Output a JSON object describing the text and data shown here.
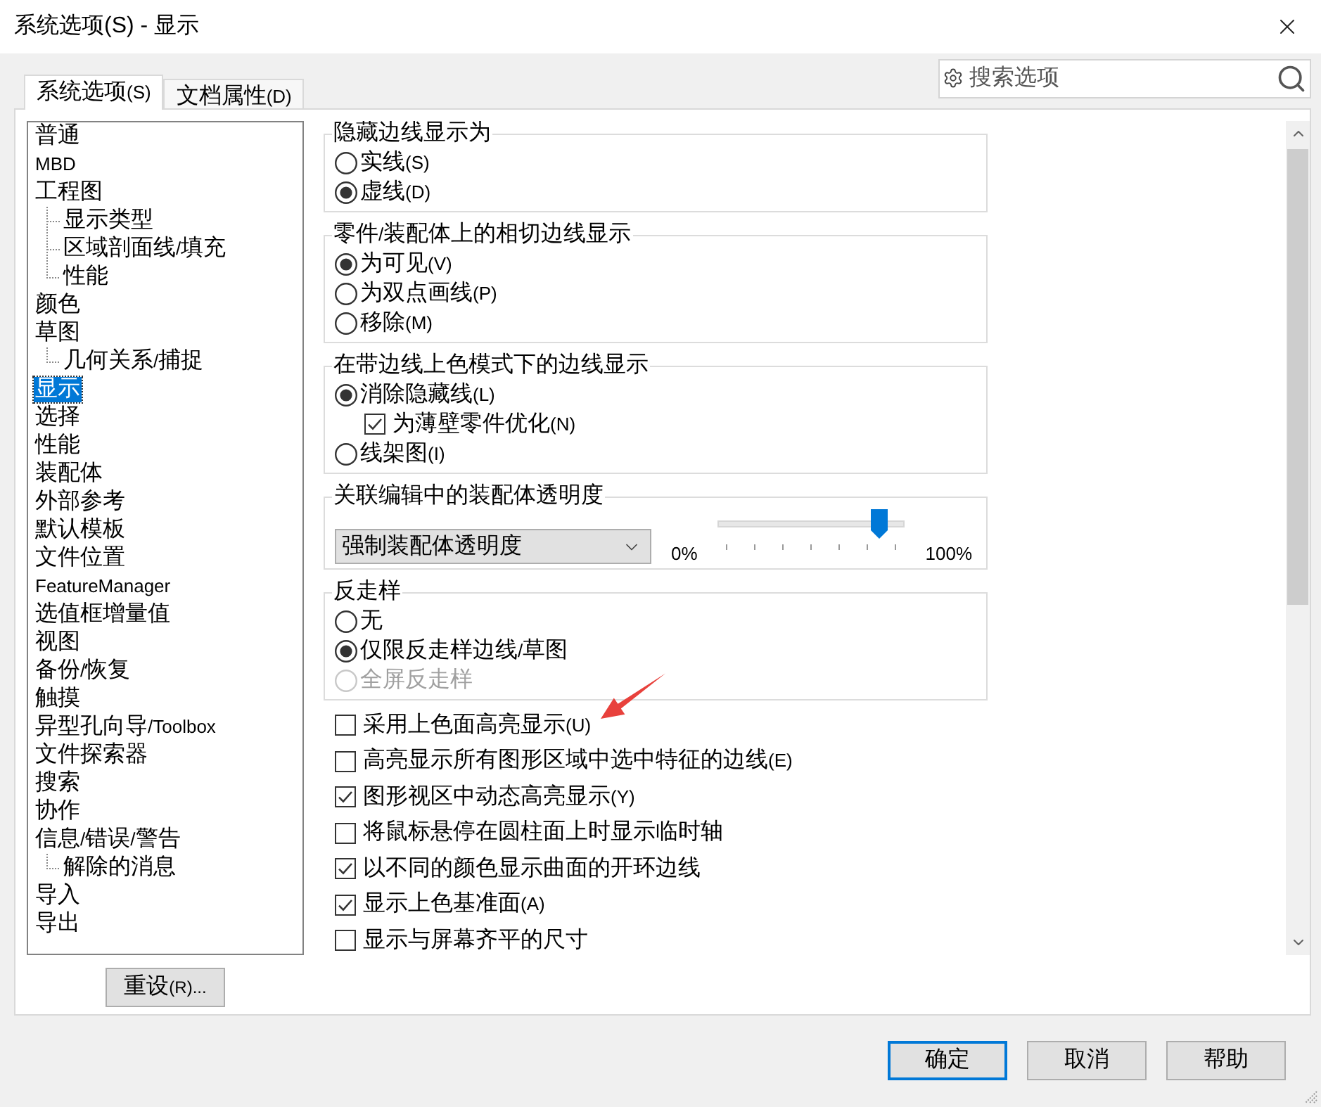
{
  "window": {
    "title": "系统选项(S) - 显示"
  },
  "tabs": [
    {
      "label": "系统选项(S)",
      "selected": true
    },
    {
      "label": "文档属性(D)",
      "selected": false
    }
  ],
  "search": {
    "placeholder": "搜索选项"
  },
  "sidebar": {
    "items": [
      {
        "label": "普通",
        "selected": false
      },
      {
        "label": "MBD",
        "selected": false
      },
      {
        "label": "工程图",
        "selected": false,
        "children": [
          {
            "label": "显示类型",
            "selected": false
          },
          {
            "label": "区域剖面线/填充",
            "selected": false
          },
          {
            "label": "性能",
            "selected": false
          }
        ]
      },
      {
        "label": "颜色",
        "selected": false
      },
      {
        "label": "草图",
        "selected": false,
        "children": [
          {
            "label": "几何关系/捕捉",
            "selected": false
          }
        ]
      },
      {
        "label": "显示",
        "selected": true
      },
      {
        "label": "选择",
        "selected": false
      },
      {
        "label": "性能",
        "selected": false
      },
      {
        "label": "装配体",
        "selected": false
      },
      {
        "label": "外部参考",
        "selected": false
      },
      {
        "label": "默认模板",
        "selected": false
      },
      {
        "label": "文件位置",
        "selected": false
      },
      {
        "label": "FeatureManager",
        "selected": false
      },
      {
        "label": "选值框增量值",
        "selected": false
      },
      {
        "label": "视图",
        "selected": false
      },
      {
        "label": "备份/恢复",
        "selected": false
      },
      {
        "label": "触摸",
        "selected": false
      },
      {
        "label": "异型孔向导/Toolbox",
        "selected": false
      },
      {
        "label": "文件探索器",
        "selected": false
      },
      {
        "label": "搜索",
        "selected": false
      },
      {
        "label": "协作",
        "selected": false
      },
      {
        "label": "信息/错误/警告",
        "selected": false,
        "children": [
          {
            "label": "解除的消息",
            "selected": false
          }
        ]
      },
      {
        "label": "导入",
        "selected": false
      },
      {
        "label": "导出",
        "selected": false
      }
    ]
  },
  "reset_button": {
    "label": "重设(R)..."
  },
  "groups": [
    {
      "kind": "options",
      "title": "隐藏边线显示为",
      "options": [
        {
          "kind": "radio",
          "label": "实线(S)",
          "selected": false
        },
        {
          "kind": "radio",
          "label": "虚线(D)",
          "selected": true
        }
      ]
    },
    {
      "kind": "options",
      "title": "零件/装配体上的相切边线显示",
      "options": [
        {
          "kind": "radio",
          "label": "为可见(V)",
          "selected": true
        },
        {
          "kind": "radio",
          "label": "为双点画线(P)",
          "selected": false
        },
        {
          "kind": "radio",
          "label": "移除(M)",
          "selected": false
        }
      ]
    },
    {
      "kind": "options",
      "title": "在带边线上色模式下的边线显示",
      "options": [
        {
          "kind": "radio",
          "label": "消除隐藏线(L)",
          "selected": true
        },
        {
          "kind": "checkbox",
          "label": "为薄壁零件优化(N)",
          "checked": true
        },
        {
          "kind": "radio",
          "label": "线架图(I)",
          "selected": false
        }
      ]
    },
    {
      "kind": "transparency",
      "title": "关联编辑中的装配体透明度",
      "dropdown": {
        "value": "强制装配体透明度"
      },
      "slider": {
        "min_label": "0%",
        "max_label": "100%",
        "level": 0.9
      }
    },
    {
      "kind": "options",
      "title": "反走样",
      "options": [
        {
          "kind": "radio",
          "label": "无",
          "selected": false,
          "disabled": false
        },
        {
          "kind": "radio",
          "label": "仅限反走样边线/草图",
          "selected": true,
          "disabled": false
        },
        {
          "kind": "radio",
          "label": "全屏反走样",
          "selected": false,
          "disabled": true
        }
      ]
    }
  ],
  "checkboxes": [
    {
      "label": "采用上色面高亮显示(U)",
      "checked": false
    },
    {
      "label": "高亮显示所有图形区域中选中特征的边线(E)",
      "checked": false
    },
    {
      "label": "图形视区中动态高亮显示(Y)",
      "checked": true
    },
    {
      "label": "将鼠标悬停在圆柱面上时显示临时轴",
      "checked": false
    },
    {
      "label": "以不同的颜色显示曲面的开环边线",
      "checked": true
    },
    {
      "label": "显示上色基准面(A)",
      "checked": true
    },
    {
      "label": "显示与屏幕齐平的尺寸",
      "checked": false
    }
  ],
  "buttons": [
    {
      "label": "确定",
      "default": true
    },
    {
      "label": "取消",
      "default": false
    },
    {
      "label": "帮助",
      "default": false
    }
  ]
}
